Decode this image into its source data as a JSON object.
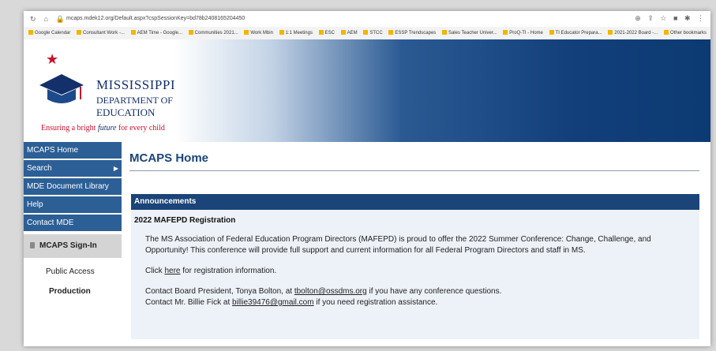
{
  "browser": {
    "url": "mcaps.mdek12.org/Default.aspx?cspSessionKey=bd78b2408165204450",
    "bookmarks": [
      "Google Calendar",
      "Consultant Work -...",
      "AEM Time - Google...",
      "Communities 2021...",
      "Work Mbin",
      "1:1 Meetings",
      "ESC",
      "AEM",
      "STCC",
      "ESSP Trendscapes",
      "Sales Teacher Univer...",
      "ProQ-TI - Home",
      "TI Educator Prepara...",
      "2021-2022 Board -...",
      "Other bookmarks"
    ]
  },
  "logo": {
    "line1": "MISSISSIPPI",
    "line2": "DEPARTMENT OF",
    "line3": "EDUCATION",
    "tagline_before": "Ensuring a bright ",
    "tagline_em": "future",
    "tagline_after": " for every child"
  },
  "sidebar": {
    "items": [
      {
        "label": "MCAPS Home"
      },
      {
        "label": "Search",
        "arrow": "▶"
      },
      {
        "label": "MDE Document Library"
      },
      {
        "label": "Help"
      },
      {
        "label": "Contact MDE"
      }
    ],
    "signin_label": "MCAPS Sign-In",
    "public_access": "Public Access",
    "production": "Production"
  },
  "main": {
    "title": "MCAPS Home",
    "announcements": {
      "header": "Announcements",
      "subject": "2022 MAFEPD Registration",
      "para1": "The MS Association of Federal Education Program Directors (MAFEPD) is proud to offer the 2022 Summer Conference: Change, Challenge, and Opportunity! This conference will provide full support and current information for all Federal Program Directors and staff in MS.",
      "click_before": "Click ",
      "click_link": "here",
      "click_after": " for registration information.",
      "contact1_before": "Contact Board President, Tonya Bolton, at ",
      "contact1_email": "tbolton@ossdms.org",
      "contact1_after": " if you have any conference questions.",
      "contact2_before": "Contact Mr. Billie Fick at ",
      "contact2_email": "billie39476@gmail.com",
      "contact2_after": " if you need registration assistance."
    }
  }
}
